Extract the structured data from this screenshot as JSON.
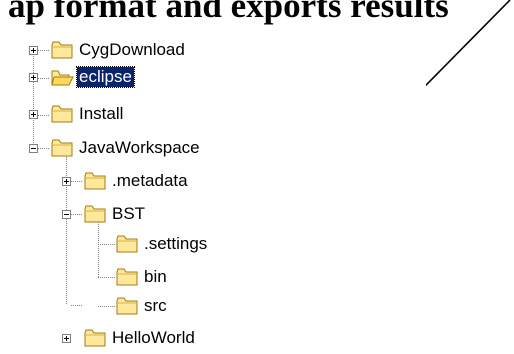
{
  "caption": {
    "text": "ap format and exports results"
  },
  "tree": {
    "nodes": [
      {
        "label": "CygDownload",
        "expander": "plus",
        "icon": "folder-closed-icon",
        "selected": false
      },
      {
        "label": "eclipse",
        "expander": "plus",
        "icon": "folder-open-icon",
        "selected": true
      },
      {
        "label": "Install",
        "expander": "plus",
        "icon": "folder-closed-icon",
        "selected": false
      },
      {
        "label": "JavaWorkspace",
        "expander": "minus",
        "icon": "folder-closed-icon",
        "selected": false
      },
      {
        "label": ".metadata",
        "expander": "plus",
        "icon": "folder-closed-icon",
        "selected": false
      },
      {
        "label": "BST",
        "expander": "minus",
        "icon": "folder-closed-icon",
        "selected": false
      },
      {
        "label": ".settings",
        "expander": "none",
        "icon": "folder-closed-icon",
        "selected": false
      },
      {
        "label": "bin",
        "expander": "none",
        "icon": "folder-closed-icon",
        "selected": false
      },
      {
        "label": "src",
        "expander": "none",
        "icon": "folder-closed-icon",
        "selected": false
      },
      {
        "label": "HelloWorld",
        "expander": "plus",
        "icon": "folder-closed-icon",
        "selected": false
      }
    ]
  },
  "colors": {
    "selection_bg": "#0a246a",
    "folder_fill": "#ffe79c",
    "folder_outline": "#a07b10",
    "tree_line": "#808080",
    "arrow": "#000000"
  },
  "annotation": {
    "icon": "arrow-icon",
    "points_to": "src"
  }
}
